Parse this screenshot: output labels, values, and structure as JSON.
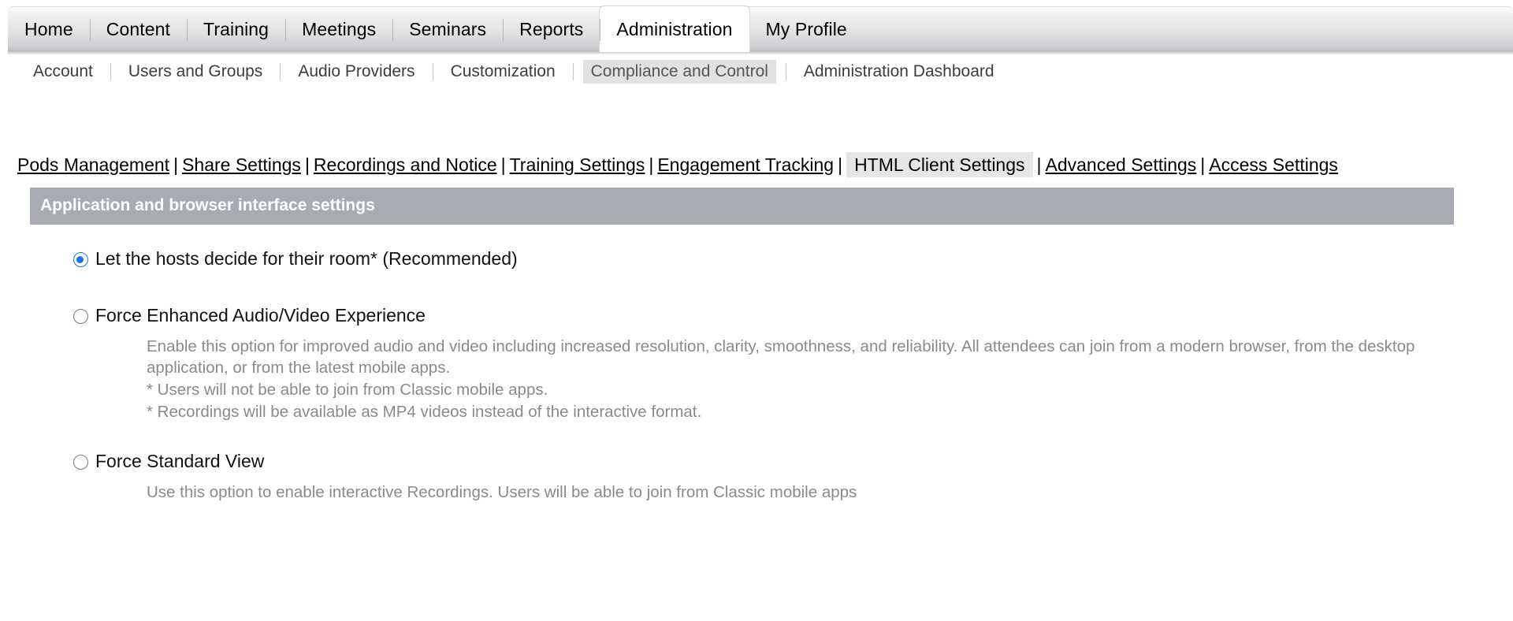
{
  "primary_nav": {
    "tabs": [
      {
        "label": "Home",
        "active": false
      },
      {
        "label": "Content",
        "active": false
      },
      {
        "label": "Training",
        "active": false
      },
      {
        "label": "Meetings",
        "active": false
      },
      {
        "label": "Seminars",
        "active": false
      },
      {
        "label": "Reports",
        "active": false
      },
      {
        "label": "Administration",
        "active": true
      },
      {
        "label": "My Profile",
        "active": false
      }
    ]
  },
  "secondary_nav": {
    "items": [
      {
        "label": "Account",
        "selected": false
      },
      {
        "label": "Users and Groups",
        "selected": false
      },
      {
        "label": "Audio Providers",
        "selected": false
      },
      {
        "label": "Customization",
        "selected": false
      },
      {
        "label": "Compliance and Control",
        "selected": true
      },
      {
        "label": "Administration Dashboard",
        "selected": false
      }
    ]
  },
  "sub_tabs": {
    "separator": "|",
    "items": [
      {
        "label": "Pods Management",
        "current": false
      },
      {
        "label": "Share Settings",
        "current": false
      },
      {
        "label": "Recordings and Notice",
        "current": false
      },
      {
        "label": "Training Settings",
        "current": false
      },
      {
        "label": "Engagement Tracking",
        "current": false
      },
      {
        "label": "HTML Client Settings",
        "current": true
      },
      {
        "label": "Advanced Settings",
        "current": false
      },
      {
        "label": "Access Settings",
        "current": false
      }
    ]
  },
  "panel": {
    "title": "Application and browser interface settings",
    "header_bg": "#a8acb2",
    "accent_color": "#1a73e8",
    "options": [
      {
        "label": "Let the hosts decide for their room* (Recommended)",
        "checked": true,
        "description": "",
        "notes": []
      },
      {
        "label": "Force Enhanced Audio/Video Experience",
        "checked": false,
        "description": "Enable this option for improved audio and video including increased resolution, clarity, smoothness, and reliability. All attendees can join from a modern browser, from the desktop application, or from the latest mobile apps.",
        "notes": [
          "* Users will not be able to join from Classic mobile apps.",
          "* Recordings will be available as MP4 videos instead of the interactive format."
        ]
      },
      {
        "label": "Force Standard View",
        "checked": false,
        "description": "Use this option to enable interactive Recordings. Users will be able to join from Classic mobile apps",
        "notes": []
      }
    ]
  }
}
